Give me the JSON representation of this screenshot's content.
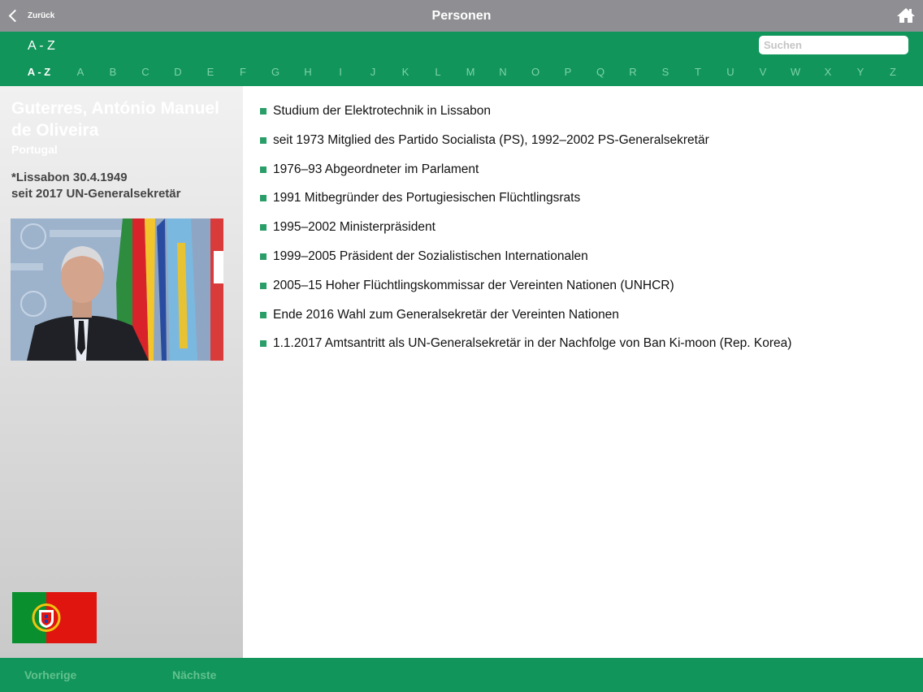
{
  "header": {
    "back_label": "Zurück",
    "title": "Personen"
  },
  "filter": {
    "heading": "A - Z",
    "search_placeholder": "Suchen",
    "letters": [
      "A - Z",
      "A",
      "B",
      "C",
      "D",
      "E",
      "F",
      "G",
      "H",
      "I",
      "J",
      "K",
      "L",
      "M",
      "N",
      "O",
      "P",
      "Q",
      "R",
      "S",
      "T",
      "U",
      "V",
      "W",
      "X",
      "Y",
      "Z"
    ],
    "active_letter": "A - Z"
  },
  "person": {
    "name": "Guterres, António Manuel de Oliveira",
    "country": "Portugal",
    "birth": "*Lissabon 30.4.1949",
    "role": "seit 2017 UN-Generalsekretär"
  },
  "biography": [
    "Studium der Elektrotechnik in Lissabon",
    "seit 1973 Mitglied des Partido Socialista (PS), 1992–2002 PS-Generalsekretär",
    "1976–93 Abgeordneter im Parlament",
    "1991 Mitbegründer des Portugiesischen Flüchtlingsrats",
    "1995–2002 Ministerpräsident",
    "1999–2005 Präsident der Sozialistischen Internationalen",
    "2005–15 Hoher Flüchtlingskommissar der Vereinten Nationen (UNHCR)",
    "Ende 2016 Wahl zum Generalsekretär der Vereinten Nationen",
    "1.1.2017 Amtsantritt als UN-Generalsekretär in der Nachfolge von Ban Ki-moon (Rep. Korea)"
  ],
  "footer": {
    "prev_label": "Vorherige",
    "next_label": "Nächste"
  },
  "colors": {
    "accent_green": "#11955a",
    "header_gray": "#8f8f93",
    "inactive_letter": "#7ed3a8",
    "bullet": "#2a9e68"
  },
  "icons": {
    "back": "chevron-left-icon",
    "home": "home-icon"
  }
}
